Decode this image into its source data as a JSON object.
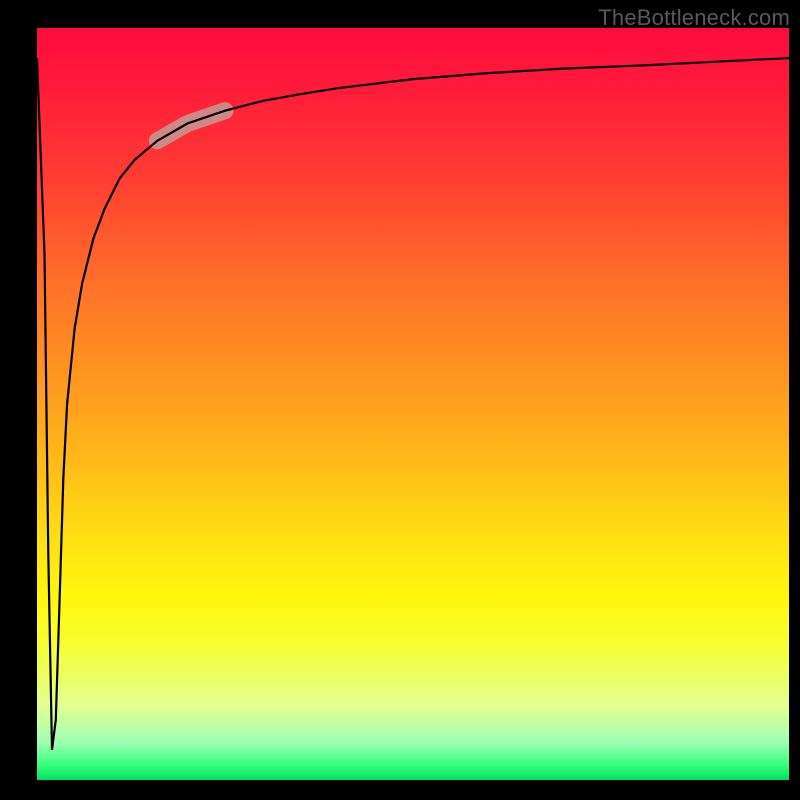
{
  "watermark": {
    "text": "TheBottleneck.com"
  },
  "chart_data": {
    "type": "line",
    "title": "",
    "xlabel": "",
    "ylabel": "",
    "xlim": [
      0,
      1
    ],
    "ylim": [
      0,
      100
    ],
    "grid": false,
    "legend": false,
    "background_gradient": {
      "direction": "vertical",
      "stops": [
        {
          "pos": 0.0,
          "color": "#ff0a3f"
        },
        {
          "pos": 0.32,
          "color": "#ff6a2a"
        },
        {
          "pos": 0.56,
          "color": "#ffb41a"
        },
        {
          "pos": 0.82,
          "color": "#f6ff32"
        },
        {
          "pos": 1.0,
          "color": "#00e064"
        }
      ]
    },
    "series": [
      {
        "name": "bottleneck-curve",
        "x": [
          0.0,
          0.01,
          0.015,
          0.02,
          0.025,
          0.03,
          0.035,
          0.04,
          0.05,
          0.06,
          0.075,
          0.09,
          0.11,
          0.13,
          0.16,
          0.2,
          0.25,
          0.3,
          0.35,
          0.4,
          0.5,
          0.6,
          0.7,
          0.8,
          0.9,
          1.0
        ],
        "y": [
          96,
          70,
          30,
          4,
          8,
          24,
          40,
          50,
          60,
          66,
          72,
          76,
          80,
          82.5,
          85,
          87.3,
          89,
          90.3,
          91.2,
          92,
          93.2,
          94,
          94.6,
          95,
          95.5,
          96
        ]
      }
    ],
    "highlight_segment": {
      "series": "bottleneck-curve",
      "x_start": 0.16,
      "x_end": 0.25,
      "color": "#cd8986",
      "width": 17
    }
  }
}
